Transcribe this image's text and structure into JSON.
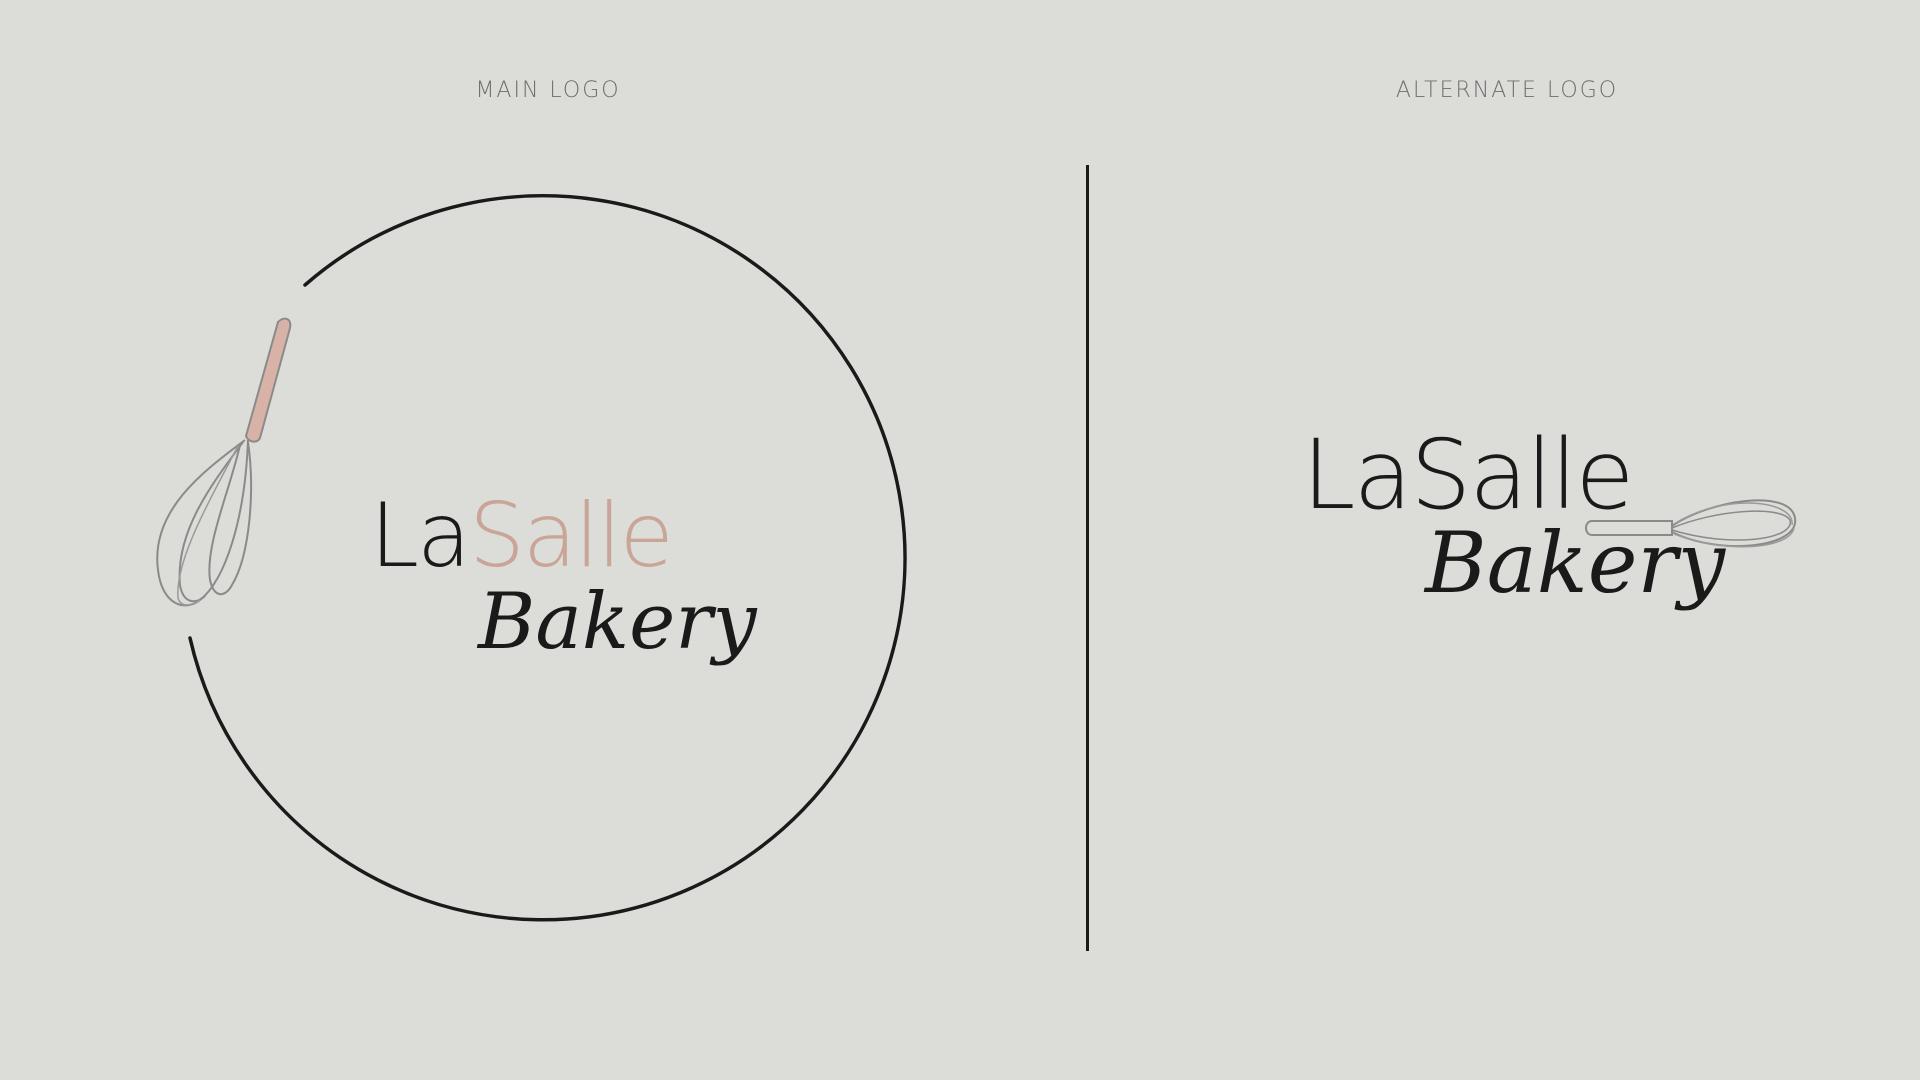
{
  "sections": {
    "main_label": "MAIN LOGO",
    "alternate_label": "ALTERNATE LOGO"
  },
  "main_logo": {
    "brand_part1": "La",
    "brand_part2": "Salle",
    "script": "Bakery",
    "icon": "whisk-icon"
  },
  "alternate_logo": {
    "brand": "LaSalle",
    "script": "Bakery",
    "icon": "whisk-icon"
  },
  "colors": {
    "background": "#dcddd8",
    "ink": "#1a1a1a",
    "accent_rose": "#c9a597",
    "label_gray": "#6e6e6e"
  }
}
